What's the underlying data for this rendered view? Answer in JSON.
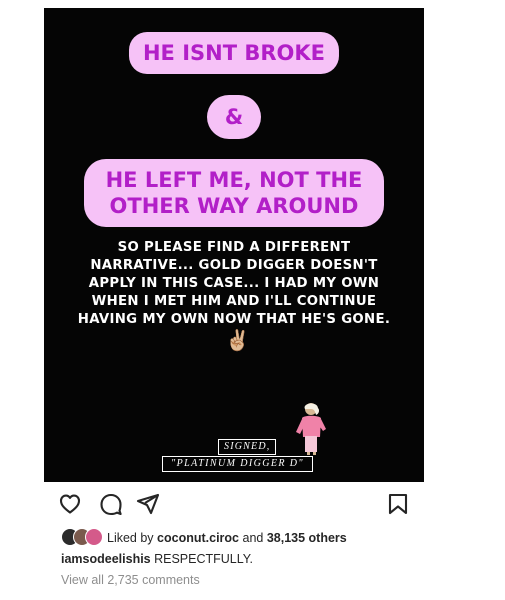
{
  "story": {
    "headline_1": "HE ISNT BROKE",
    "ampersand": "&",
    "headline_2": "HE LEFT ME, NOT THE OTHER WAY AROUND",
    "body": "SO PLEASE FIND A DIFFERENT NARRATIVE... GOLD DIGGER DOESN'T APPLY IN THIS CASE... I HAD MY OWN WHEN I MET HIM AND I'LL CONTINUE HAVING MY OWN NOW THAT HE'S GONE.",
    "emoji": "✌🏼",
    "signed_label": "SIGNED,",
    "signature_name": "\"PLATINUM DIGGER D\"",
    "pill_bg": "#f6c2f7",
    "pill_text": "#b21fc8",
    "background": "#050505"
  },
  "actions": {
    "like_icon": "heart-icon",
    "comment_icon": "comment-icon",
    "share_icon": "share-icon",
    "save_icon": "bookmark-icon"
  },
  "likes": {
    "prefix": "Liked by",
    "user": "coconut.ciroc",
    "connector": "and",
    "count": "38,135 others"
  },
  "caption": {
    "username": "iamsodeelishis",
    "text": "RESPECTFULLY."
  },
  "comments": {
    "link_text": "View all 2,735 comments"
  }
}
